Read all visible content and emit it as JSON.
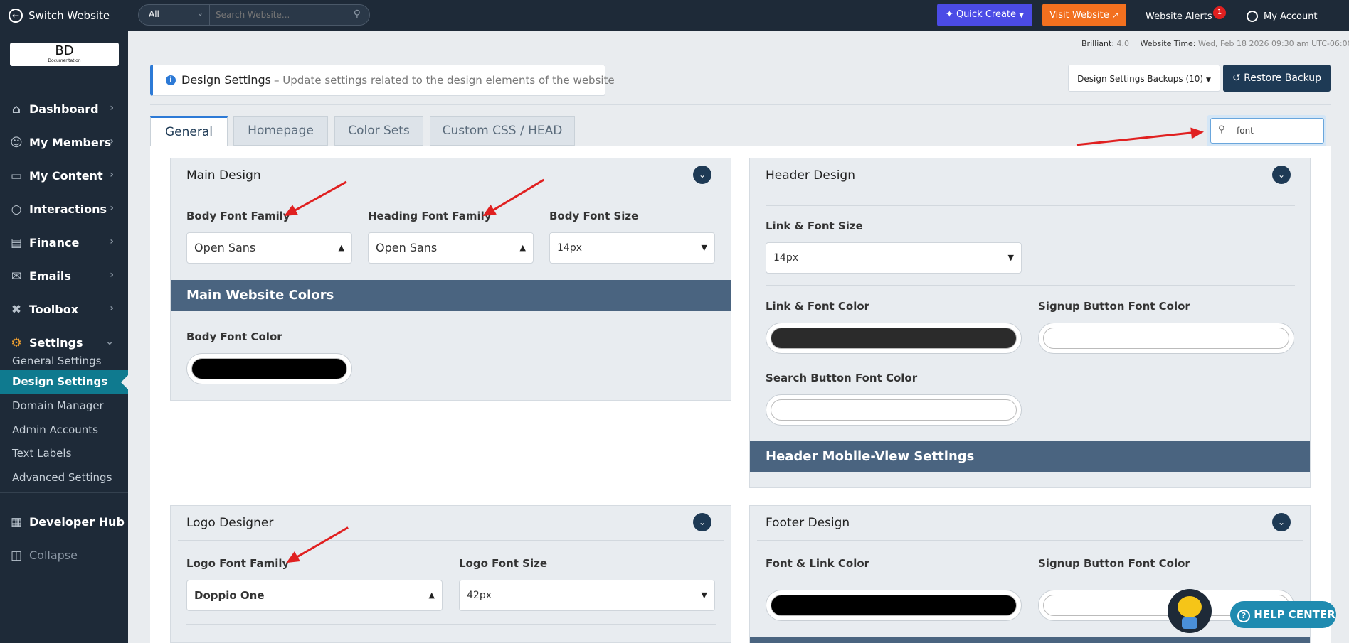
{
  "topbar": {
    "switch_label": "Switch Website",
    "search_scope": "All",
    "search_placeholder": "Search Website...",
    "quick_create": "Quick Create",
    "visit_website": "Visit Website",
    "alerts_label": "Website Alerts",
    "alerts_count": "1",
    "account_label": "My Account"
  },
  "logo_text": "BD",
  "logo_sub": "Documentation",
  "nav": [
    {
      "label": "Dashboard",
      "icon": "home-icon"
    },
    {
      "label": "My Members",
      "icon": "members-icon"
    },
    {
      "label": "My Content",
      "icon": "folder-icon"
    },
    {
      "label": "Interactions",
      "icon": "chat-icon"
    },
    {
      "label": "Finance",
      "icon": "bar-chart-icon"
    },
    {
      "label": "Emails",
      "icon": "mail-icon"
    },
    {
      "label": "Toolbox",
      "icon": "tools-icon"
    },
    {
      "label": "Settings",
      "icon": "gear-icon"
    }
  ],
  "subnav": [
    "General Settings",
    "Design Settings",
    "Domain Manager",
    "Admin Accounts",
    "Text Labels",
    "Advanced Settings"
  ],
  "developer_hub": "Developer Hub",
  "collapse": "Collapse",
  "status": {
    "version_label": "Brilliant:",
    "version": "4.0",
    "time_label": "Website Time:",
    "time": "Wed, Feb 18 2026 09:30 am UTC-06:00"
  },
  "page": {
    "title": "Design Settings",
    "subtitle": "– Update settings related to the design elements of the website",
    "backups_button": "Design Settings Backups (10)",
    "restore_button": "Restore Backup",
    "filter_value": "font"
  },
  "tabs": [
    "General",
    "Homepage",
    "Color Sets",
    "Custom CSS / HEAD"
  ],
  "main_design": {
    "title": "Main Design",
    "body_font_label": "Body Font Family",
    "body_font_value": "Open Sans",
    "heading_font_label": "Heading Font Family",
    "heading_font_value": "Open Sans",
    "body_size_label": "Body Font Size",
    "body_size_value": "14px",
    "colors_bar": "Main Website Colors",
    "body_color_label": "Body Font Color"
  },
  "header_design": {
    "title": "Header Design",
    "link_size_label": "Link & Font Size",
    "link_size_value": "14px",
    "link_color_label": "Link & Font Color",
    "signup_color_label": "Signup Button Font Color",
    "search_color_label": "Search Button Font Color",
    "mobile_bar": "Header Mobile-View Settings"
  },
  "logo_designer": {
    "title": "Logo Designer",
    "font_label": "Logo Font Family",
    "font_value": "Doppio One",
    "size_label": "Logo Font Size",
    "size_value": "42px"
  },
  "footer_design": {
    "title": "Footer Design",
    "link_color_label": "Font & Link Color",
    "signup_color_label": "Signup Button Font Color"
  },
  "help_center": "HELP CENTER",
  "colors": {
    "accent": "#2d7ad6",
    "quick_create": "#4b4be6",
    "visit_website": "#f2701f",
    "restore": "#1e3a55",
    "body_font_color": "#000000",
    "header_link_color": "#2b2b2b",
    "header_signup_color": "#ffffff",
    "header_search_color": "#ffffff",
    "footer_link_color": "#000000",
    "footer_signup_color": "#ffffff"
  }
}
